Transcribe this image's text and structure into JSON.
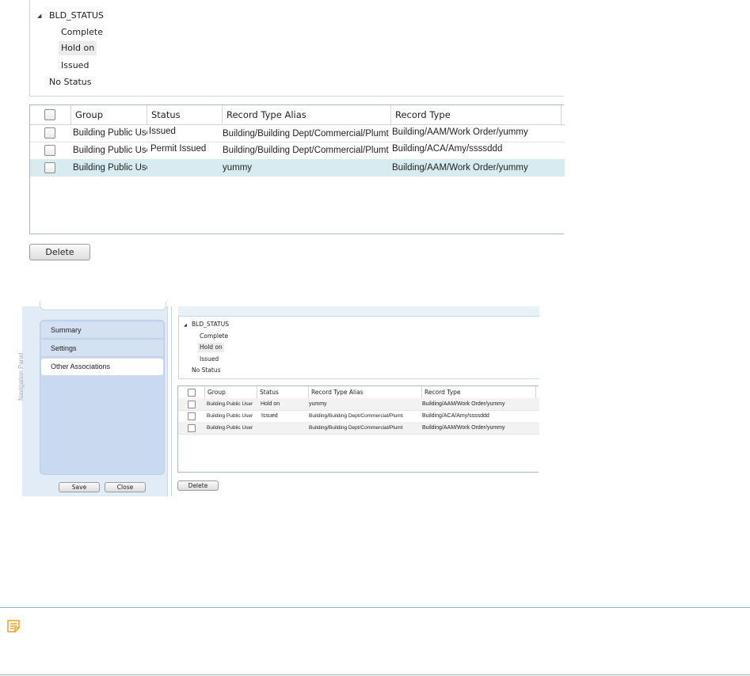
{
  "screenshot1": {
    "tree": {
      "root_label": "BLD_STATUS",
      "children": [
        "Complete",
        "Hold on",
        "Issued"
      ],
      "sibling": "No Status",
      "expander": "◢"
    },
    "table": {
      "headers": [
        "Group",
        "Status",
        "Record Type Alias",
        "Record Type"
      ],
      "rows": [
        {
          "group": "Building Public User",
          "status": "Issued",
          "alias": "Building/Building Dept/Commercial/Plumt",
          "type": "Building/AAM/Work Order/yummy"
        },
        {
          "group": "Building Public User",
          "status": "Permit Issued",
          "alias": "Building/Building Dept/Commercial/Plumt",
          "type": "Building/ACA/Amy/ssssddd"
        },
        {
          "group": "Building Public User",
          "status": "",
          "alias": "yummy",
          "type": "Building/AAM/Work Order/yummy"
        }
      ]
    },
    "delete_label": "Delete"
  },
  "screenshot2": {
    "nav": {
      "vertical_label": "Navigation Panel",
      "items": [
        "Summary",
        "Settings",
        "Other Associations"
      ],
      "save_label": "Save",
      "close_label": "Close"
    },
    "tree": {
      "root_label": "BLD_STATUS",
      "children": [
        "Complete",
        "Hold on",
        "Issued"
      ],
      "sibling": "No Status",
      "expander": "◢"
    },
    "table": {
      "headers": [
        "Group",
        "Status",
        "Record Type Alias",
        "Record Type"
      ],
      "rows": [
        {
          "group": "Building Public User",
          "status": "Hold on",
          "alias": "yummy",
          "type": "Building/AAM/Work Order/yummy"
        },
        {
          "group": "Building Public User",
          "status": "Issued",
          "alias": "Building/Building Dept/Commercial/Plumt",
          "type": "Building/ACA/Amy/ssssddd"
        },
        {
          "group": "Building Public User",
          "status": "",
          "alias": "Building/Building Dept/Commercial/Plumt",
          "type": "Building/AAM/Work Order/yummy"
        }
      ]
    },
    "delete_label": "Delete"
  },
  "note": {
    "icon": "note-icon",
    "accent_color": "#f0a020",
    "border_color": "#8fb8c4"
  },
  "colors": {
    "selected_row": "#d8ecf0",
    "nav_background": "#e2ecf6",
    "nav_box": "#c9daf0"
  }
}
